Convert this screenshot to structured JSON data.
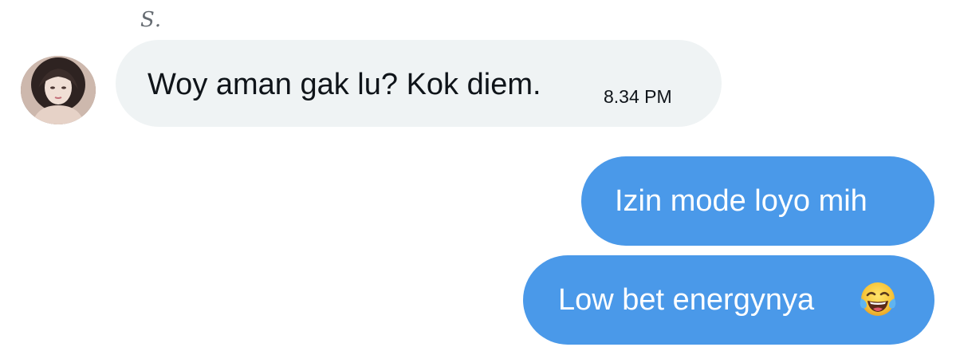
{
  "sender": {
    "name": "S."
  },
  "messages": [
    {
      "direction": "incoming",
      "text": "Woy aman gak lu? Kok diem.",
      "time": "8.34 PM"
    },
    {
      "direction": "outgoing",
      "text": "Izin mode loyo mih"
    },
    {
      "direction": "outgoing",
      "text": "Low bet energynya",
      "emoji": "face-with-tears-of-joy"
    }
  ],
  "colors": {
    "incoming_bubble": "#eff3f4",
    "outgoing_bubble": "#4a99e9",
    "incoming_text": "#0f1419",
    "outgoing_text": "#ffffff",
    "sender_name": "#666c72"
  }
}
